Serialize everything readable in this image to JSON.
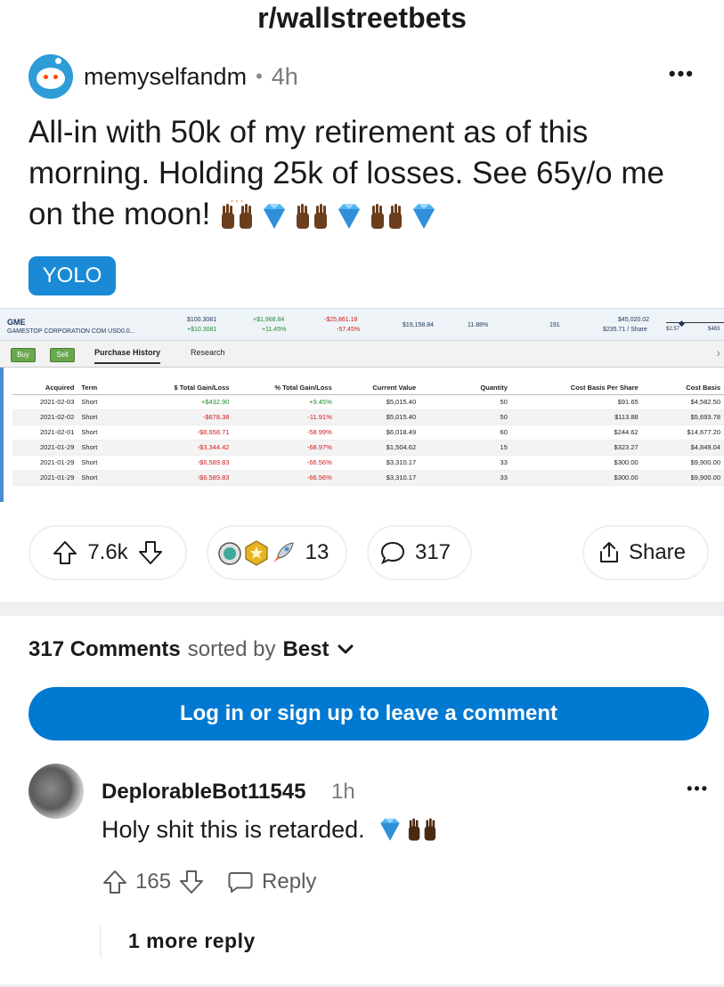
{
  "header": {
    "title": "r/wallstreetbets"
  },
  "post": {
    "username": "memyselfandm",
    "separator": "•",
    "age": "4h",
    "title": "All-in with 50k of my retirement as of this morning. Holding 25k of losses. See 65y/o me on the moon!",
    "flair": "YOLO",
    "votes": "7.6k",
    "awards_count": "13",
    "comments_count": "317",
    "share_label": "Share"
  },
  "screenshot": {
    "ticker": "GME",
    "company": "GAMESTOP CORPORATION COM USD0.0...",
    "price": "$100.3081",
    "price_change": "+$10.3081",
    "day_gain": "+$1,968.84",
    "day_gain_pct": "+11.45%",
    "total_gain": "-$25,861.18",
    "total_gain_pct": "-57.45%",
    "current_value": "$19,158.84",
    "pct_account": "11.88%",
    "quantity": "191",
    "cost_basis": "$45,020.02",
    "cost_per_share": "$235.71 / Share",
    "range_low": "$2.57",
    "range_high": "$483",
    "buy_label": "Buy",
    "sell_label": "Sell",
    "tab_history": "Purchase History",
    "tab_research": "Research",
    "columns": [
      "Acquired",
      "Term",
      "$ Total Gain/Loss",
      "% Total Gain/Loss",
      "Current Value",
      "Quantity",
      "Cost Basis Per Share",
      "Cost Basis"
    ],
    "rows": [
      [
        "2021-02-03",
        "Short",
        "+$432.90",
        "+9.45%",
        "$5,015.40",
        "50",
        "$91.65",
        "$4,582.50"
      ],
      [
        "2021-02-02",
        "Short",
        "-$678.38",
        "-11.91%",
        "$5,015.40",
        "50",
        "$113.88",
        "$5,693.78"
      ],
      [
        "2021-02-01",
        "Short",
        "-$8,658.71",
        "-58.99%",
        "$6,018.49",
        "60",
        "$244.62",
        "$14,677.20"
      ],
      [
        "2021-01-29",
        "Short",
        "-$3,344.42",
        "-68.97%",
        "$1,504.62",
        "15",
        "$323.27",
        "$4,849.04"
      ],
      [
        "2021-01-29",
        "Short",
        "-$6,589.83",
        "-66.56%",
        "$3,310.17",
        "33",
        "$300.00",
        "$9,900.00"
      ],
      [
        "2021-01-29",
        "Short",
        "-$6,589.83",
        "-66.56%",
        "$3,310.17",
        "33",
        "$300.00",
        "$9,900.00"
      ]
    ]
  },
  "comments_section": {
    "count_label": "317 Comments",
    "sorted_by": "sorted by",
    "sort": "Best",
    "login_label": "Log in or sign up to leave a comment"
  },
  "comment": {
    "username": "DeplorableBot11545",
    "age": "1h",
    "body": "Holy shit this is retarded.",
    "votes": "165",
    "reply_label": "Reply",
    "more_replies": "1 more reply"
  },
  "colors": {
    "accent": "#0079d3",
    "flair": "#1a8ad6",
    "gain": "#1e8c2f",
    "loss": "#d11a1a"
  }
}
